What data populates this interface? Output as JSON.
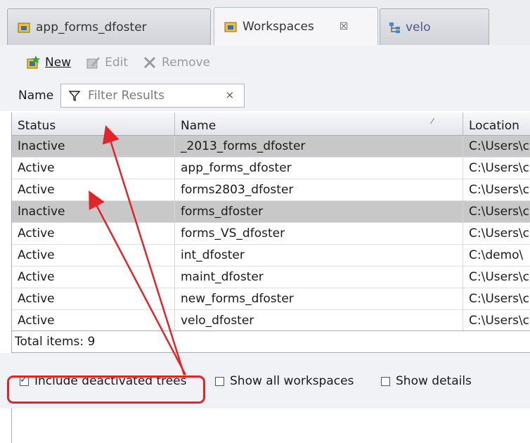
{
  "tabs": [
    {
      "label": "app_forms_dfoster",
      "icon": "workspace-icon",
      "active": false
    },
    {
      "label": "Workspaces",
      "icon": "workspace-icon",
      "active": true,
      "close": "☒"
    },
    {
      "label": "velo",
      "icon": "tree-icon",
      "active": false
    }
  ],
  "toolbar": {
    "new_label": "New",
    "edit_label": "Edit",
    "remove_label": "Remove"
  },
  "filter": {
    "label": "Name",
    "placeholder": "Filter Results",
    "clear": "×"
  },
  "table": {
    "columns": [
      "Status",
      "Name",
      "Location"
    ],
    "rows": [
      {
        "status": "Inactive",
        "name": "_2013_forms_dfoster",
        "location": "C:\\Users\\c"
      },
      {
        "status": "Active",
        "name": "app_forms_dfoster",
        "location": "C:\\Users\\c"
      },
      {
        "status": "Active",
        "name": "forms2803_dfoster",
        "location": "C:\\Users\\c"
      },
      {
        "status": "Inactive",
        "name": "forms_dfoster",
        "location": "C:\\Users\\c"
      },
      {
        "status": "Active",
        "name": "forms_VS_dfoster",
        "location": "C:\\Users\\c"
      },
      {
        "status": "Active",
        "name": "int_dfoster",
        "location": "C:\\demo\\"
      },
      {
        "status": "Active",
        "name": "maint_dfoster",
        "location": "C:\\Users\\c"
      },
      {
        "status": "Active",
        "name": "new_forms_dfoster",
        "location": "C:\\Users\\c"
      },
      {
        "status": "Active",
        "name": "velo_dfoster",
        "location": "C:\\Users\\c"
      }
    ]
  },
  "footer": {
    "total": "Total items: 9"
  },
  "options": [
    {
      "label": "Include deactivated trees",
      "checked": true
    },
    {
      "label": "Show all workspaces",
      "checked": false
    },
    {
      "label": "Show details",
      "checked": false
    }
  ],
  "colors": {
    "annotation": "#e0252b",
    "inactive_row": "#c8c8c8"
  }
}
